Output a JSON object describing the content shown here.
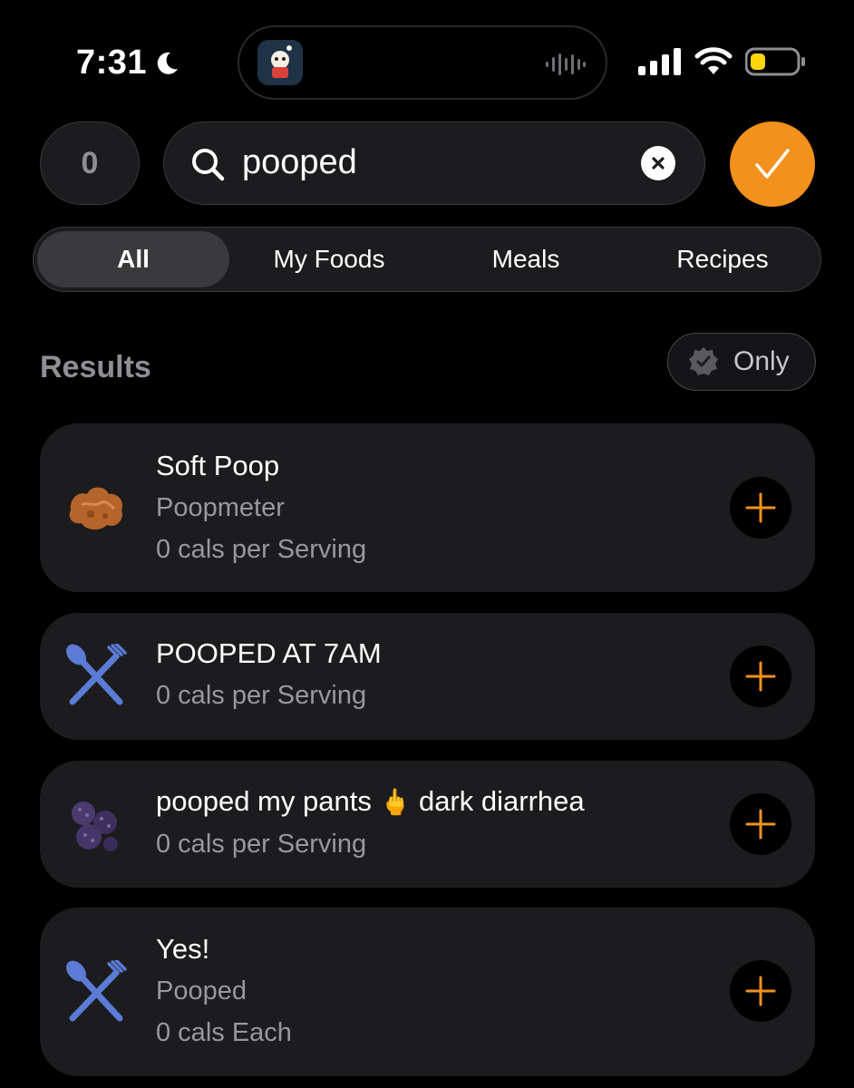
{
  "status_bar": {
    "time": "7:31"
  },
  "top": {
    "counter_value": "0",
    "search_query": "pooped"
  },
  "tabs": [
    {
      "label": "All",
      "active": true
    },
    {
      "label": "My Foods",
      "active": false
    },
    {
      "label": "Meals",
      "active": false
    },
    {
      "label": "Recipes",
      "active": false
    }
  ],
  "results": {
    "title": "Results",
    "filter_label": "Only",
    "items": [
      {
        "title": "Soft Poop",
        "brand": "Poopmeter",
        "calories": "0 cals per Serving",
        "icon": "poop-food-icon"
      },
      {
        "title": "POOPED AT 7AM",
        "calories": "0 cals per Serving",
        "icon": "utensils-icon"
      },
      {
        "title_before": "pooped my pants",
        "title_emoji": "🖕",
        "title_after": "dark diarrhea",
        "calories": "0 cals per Serving",
        "icon": "berries-icon"
      },
      {
        "title": "Yes!",
        "brand": "Pooped",
        "calories": "0 cals Each",
        "icon": "utensils-icon"
      }
    ]
  },
  "colors": {
    "accent": "#f2911b",
    "utensils": "#5b7bd5",
    "card_bg": "#1c1c1e"
  }
}
